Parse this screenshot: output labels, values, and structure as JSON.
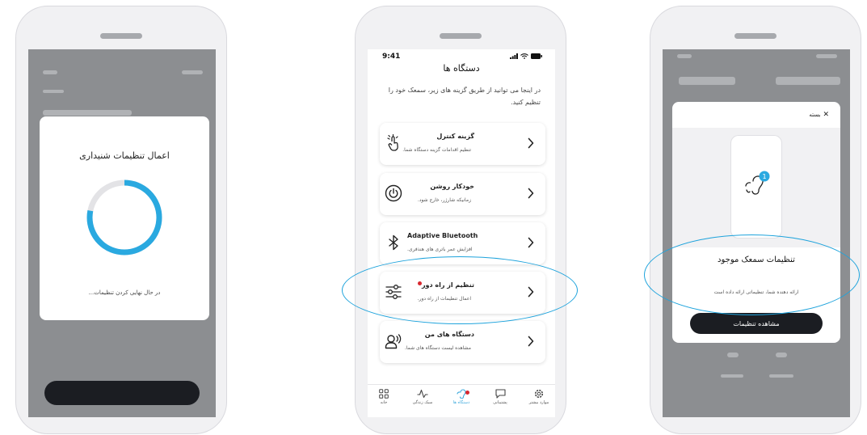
{
  "colors": {
    "accent": "#2aa9e0",
    "highlight_ring": "#1ea3dc",
    "notification_dot": "#d8282f",
    "dark_button": "#1b1d22"
  },
  "screen1": {
    "dialog_title": "اعمال تنظیمات شنیداری",
    "dialog_subtitle": "در حال نهایی کردن تنظیمات...",
    "progress_fraction": 0.78
  },
  "screen2": {
    "status_time": "9:41",
    "title": "دستگاه ها",
    "intro": "در اینجا می توانید از طریق گزینه های زیر، سمعک خود را تنظیم کنید.",
    "cards": [
      {
        "title": "گزینه کنترل",
        "subtitle": "تنظیم اقدامات گزینه دستگاه شما.",
        "icon": "tap-gesture-icon"
      },
      {
        "title": "خودکار روشن",
        "subtitle": "زمانیکه شارژر، خارج شود.",
        "icon": "power-icon"
      },
      {
        "title": "Adaptive Bluetooth",
        "subtitle": "افزایش عمر باتری های هنذفری.",
        "icon": "bluetooth-icon"
      },
      {
        "title": "تنظیم از راه دور",
        "subtitle": "اعمال تنظیمات از راه دور.",
        "icon": "sliders-icon",
        "has_badge": true
      },
      {
        "title": "دستگاه های من",
        "subtitle": "مشاهده لیست دستگاه های شما.",
        "icon": "person-sound-icon"
      }
    ],
    "tabs": [
      {
        "label": "خانه",
        "icon": "grid-icon"
      },
      {
        "label": "سبک زندگی",
        "icon": "activity-icon"
      },
      {
        "label": "دستگاه ها",
        "icon": "hearing-aid-icon",
        "active": true
      },
      {
        "label": "پشتیبانی",
        "icon": "chat-icon"
      },
      {
        "label": "موارد بیشتر",
        "icon": "gear-icon"
      }
    ]
  },
  "screen3": {
    "close_label": "بسته",
    "badge_count": "1",
    "title": "تنظیمات سمعک موجود",
    "subtitle": "ارائه دهنده شما، تنظیماتی ارائه داده است",
    "button_label": "مشاهده تنظیمات"
  }
}
